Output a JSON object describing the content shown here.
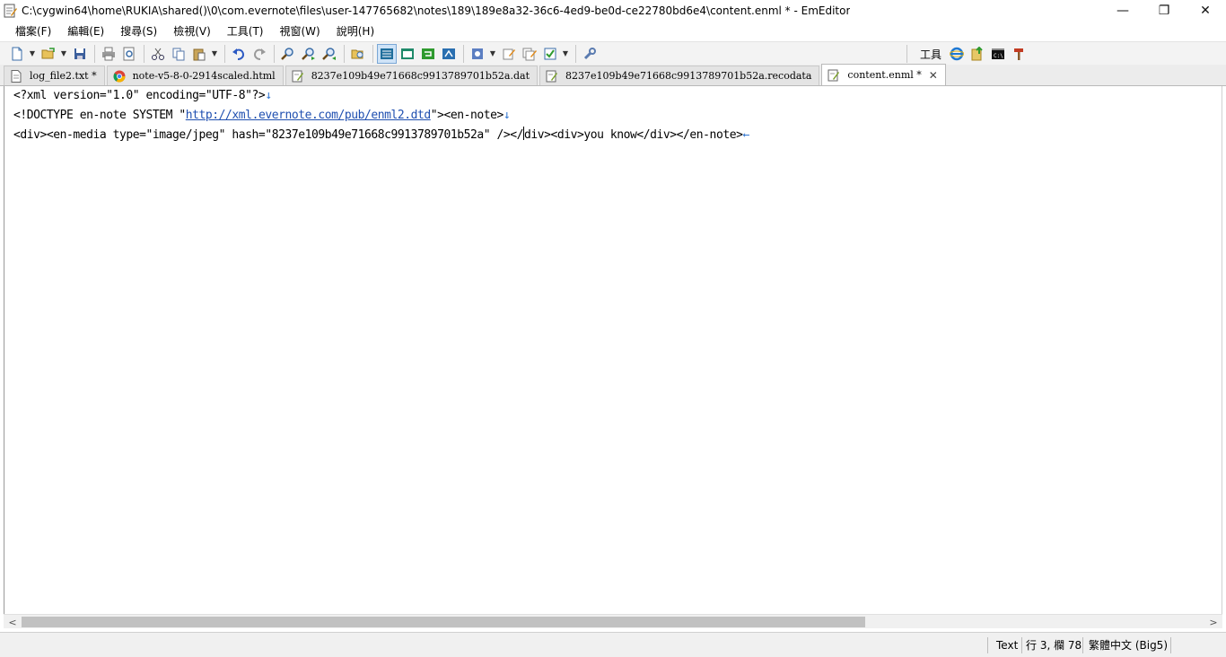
{
  "window": {
    "title": "C:\\cygwin64\\home\\RUKIA\\shared()\\0\\com.evernote\\files\\user-147765682\\notes\\189\\189e8a32-36c6-4ed9-be0d-ce22780bd6e4\\content.enml * - EmEditor",
    "minimize": "—",
    "restore": "❐",
    "close": "✕"
  },
  "menu": [
    {
      "label": "檔案(F)"
    },
    {
      "label": "編輯(E)"
    },
    {
      "label": "搜尋(S)"
    },
    {
      "label": "檢視(V)"
    },
    {
      "label": "工具(T)"
    },
    {
      "label": "視窗(W)"
    },
    {
      "label": "說明(H)"
    }
  ],
  "toolbar": {
    "tools_label": "工具",
    "icons": [
      "new-file-icon",
      "open-folder-icon",
      "save-icon",
      "print-icon",
      "print-preview-icon",
      "cut-icon",
      "copy-icon",
      "paste-icon",
      "undo-icon",
      "redo-icon",
      "find-icon",
      "find-next-icon",
      "find-previous-icon",
      "find-in-files-icon",
      "view-mode-icons",
      "macro-icon",
      "wrench-icon"
    ]
  },
  "tabs": [
    {
      "label": "log_file2.txt *",
      "icon": "text-file-icon",
      "active": false
    },
    {
      "label": "note-v5-8-0-2914scaled.html",
      "icon": "chrome-icon",
      "active": false
    },
    {
      "label": "8237e109b49e71668c9913789701b52a.dat",
      "icon": "edit-file-icon",
      "active": false
    },
    {
      "label": "8237e109b49e71668c9913789701b52a.recodata",
      "icon": "edit-file-icon",
      "active": false
    },
    {
      "label": "content.enml *",
      "icon": "edit-file-icon",
      "active": true,
      "close": "✕"
    }
  ],
  "editor": {
    "line1": "<?xml version=\"1.0\" encoding=\"UTF-8\"?>",
    "line1_eol": "↓",
    "line2_a": "<!DOCTYPE en-note SYSTEM \"",
    "line2_url": "http://xml.evernote.com/pub/enml2.dtd",
    "line2_b": "\"><en-note>",
    "line2_eol": "↓",
    "line3_a": "<div><en-media type=\"image/jpeg\" hash=\"8237e109b49e71668c9913789701b52a\" /></",
    "line3_b": "div><div>you know</div></en-note>",
    "line3_eol": "←"
  },
  "scrollbar": {
    "left_arrow": "<",
    "right_arrow": ">"
  },
  "status": {
    "mode": "Text",
    "position": "行 3, 欄 78",
    "encoding": "繁體中文 (Big5)"
  },
  "colors": {
    "eol_marker": "#2f74d0",
    "url": "#1f4fb0",
    "toolbar_bg": "#f3f3f3",
    "status_bg": "#f0f0f0"
  }
}
